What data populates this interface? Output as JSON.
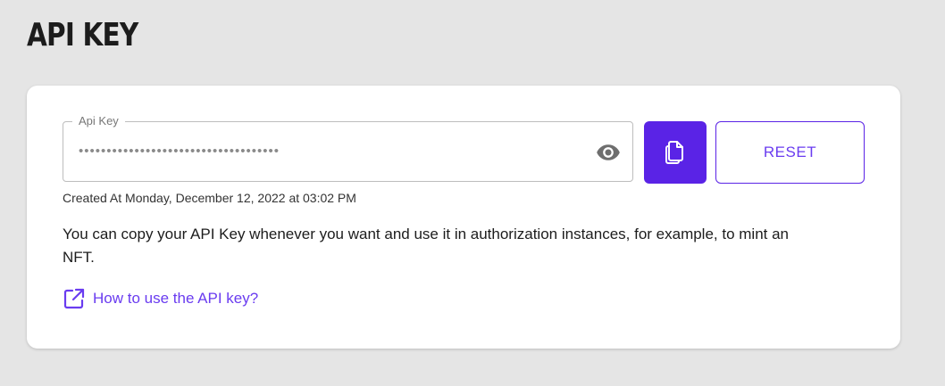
{
  "page": {
    "title": "API KEY"
  },
  "api_key": {
    "label": "Api Key",
    "masked_value": "••••••••••••••••••••••••••••••••••••",
    "visibility_icon": "eye-icon",
    "copy_icon": "copy-icon",
    "reset_label": "RESET",
    "created_at": "Created At Monday, December 12, 2022 at 03:02 PM"
  },
  "info": {
    "description": "You can copy your API Key whenever you want and use it in authorization instances, for example, to mint an NFT.",
    "help_link_label": "How to use the API key?",
    "help_link_icon": "external-link-icon"
  },
  "colors": {
    "page_background": "#e5e5e5",
    "accent": "#5a23e6",
    "link": "#6a3cf0"
  }
}
